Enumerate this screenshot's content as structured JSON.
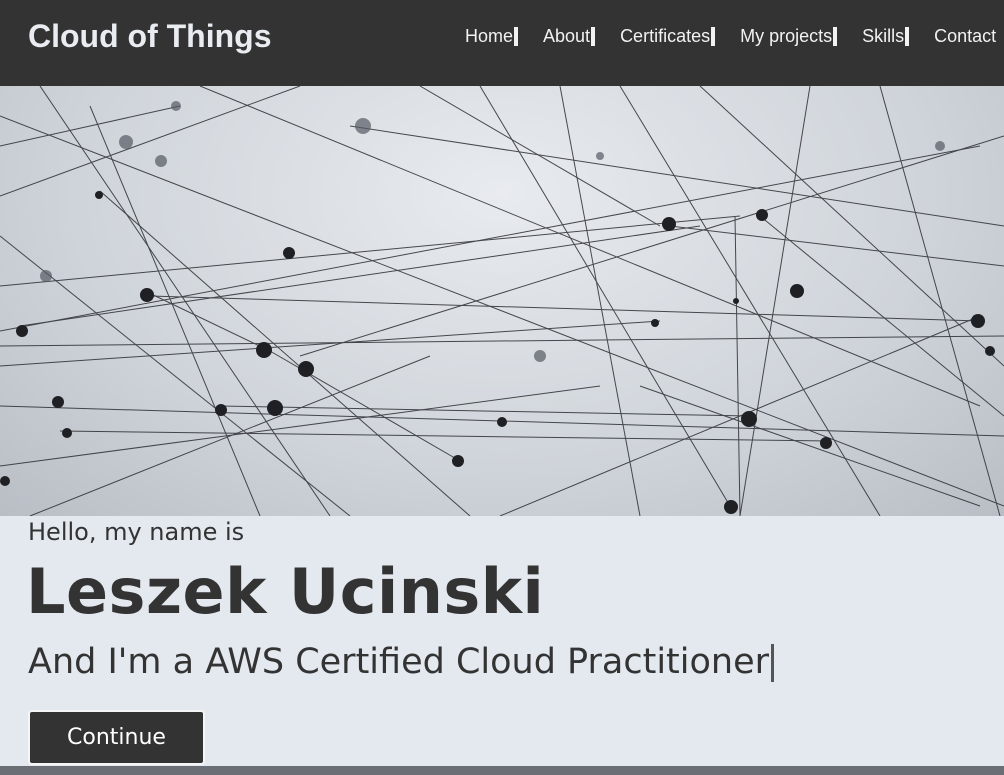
{
  "header": {
    "logo": "Cloud of Things",
    "nav": [
      "Home",
      "About",
      "Certificates",
      "My projects",
      "Skills",
      "Contact"
    ]
  },
  "hero": {
    "image_icon": "network-lines-image"
  },
  "intro": {
    "greeting": "Hello, my name is",
    "name": "Leszek Ucinski",
    "role_prefix": "And I'm a",
    "role_highlight": "AWS Certified Cloud Practitioner"
  },
  "cta": {
    "label": "Continue"
  },
  "colors": {
    "navbar": "#333333",
    "background": "#e4e9f0",
    "text": "#333333",
    "button": "#333333"
  }
}
